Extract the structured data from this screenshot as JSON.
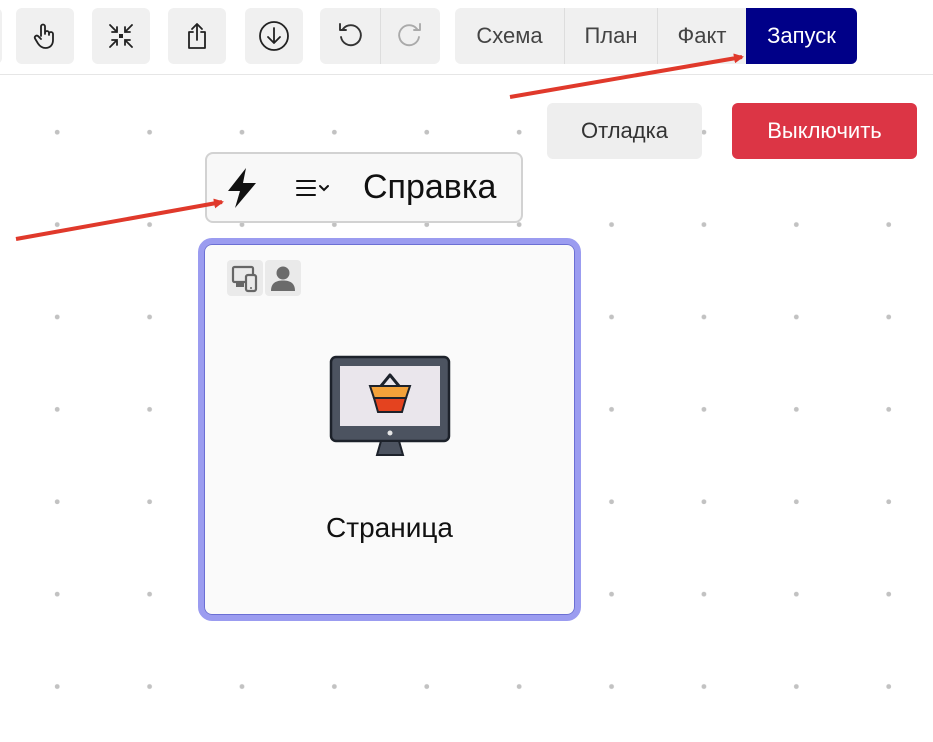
{
  "toolbar": {
    "tools": [
      {
        "icon": "pointer-hand-icon"
      },
      {
        "icon": "collapse-arrows-icon"
      },
      {
        "icon": "share-export-icon"
      },
      {
        "icon": "download-circle-icon"
      }
    ],
    "history": [
      {
        "icon": "undo-icon"
      },
      {
        "icon": "redo-icon"
      }
    ],
    "tabs": [
      {
        "label": "Схема",
        "active": false
      },
      {
        "label": "План",
        "active": false
      },
      {
        "label": "Факт",
        "active": false
      },
      {
        "label": "Запуск",
        "active": true
      }
    ]
  },
  "actions": {
    "debug_label": "Отладка",
    "disable_label": "Выключить"
  },
  "node_toolbar": {
    "trigger_icon": "lightning-bolt-icon",
    "menu_icon": "list-chevron-icon",
    "help_label": "Справка"
  },
  "node": {
    "badges": [
      "devices-icon",
      "user-icon"
    ],
    "icon": "monitor-basket-icon",
    "label": "Страница"
  },
  "colors": {
    "active_tab": "#000088",
    "disable_button": "#dc3545",
    "node_border": "#9b9cf0",
    "annotation_arrow": "#e0392b"
  }
}
